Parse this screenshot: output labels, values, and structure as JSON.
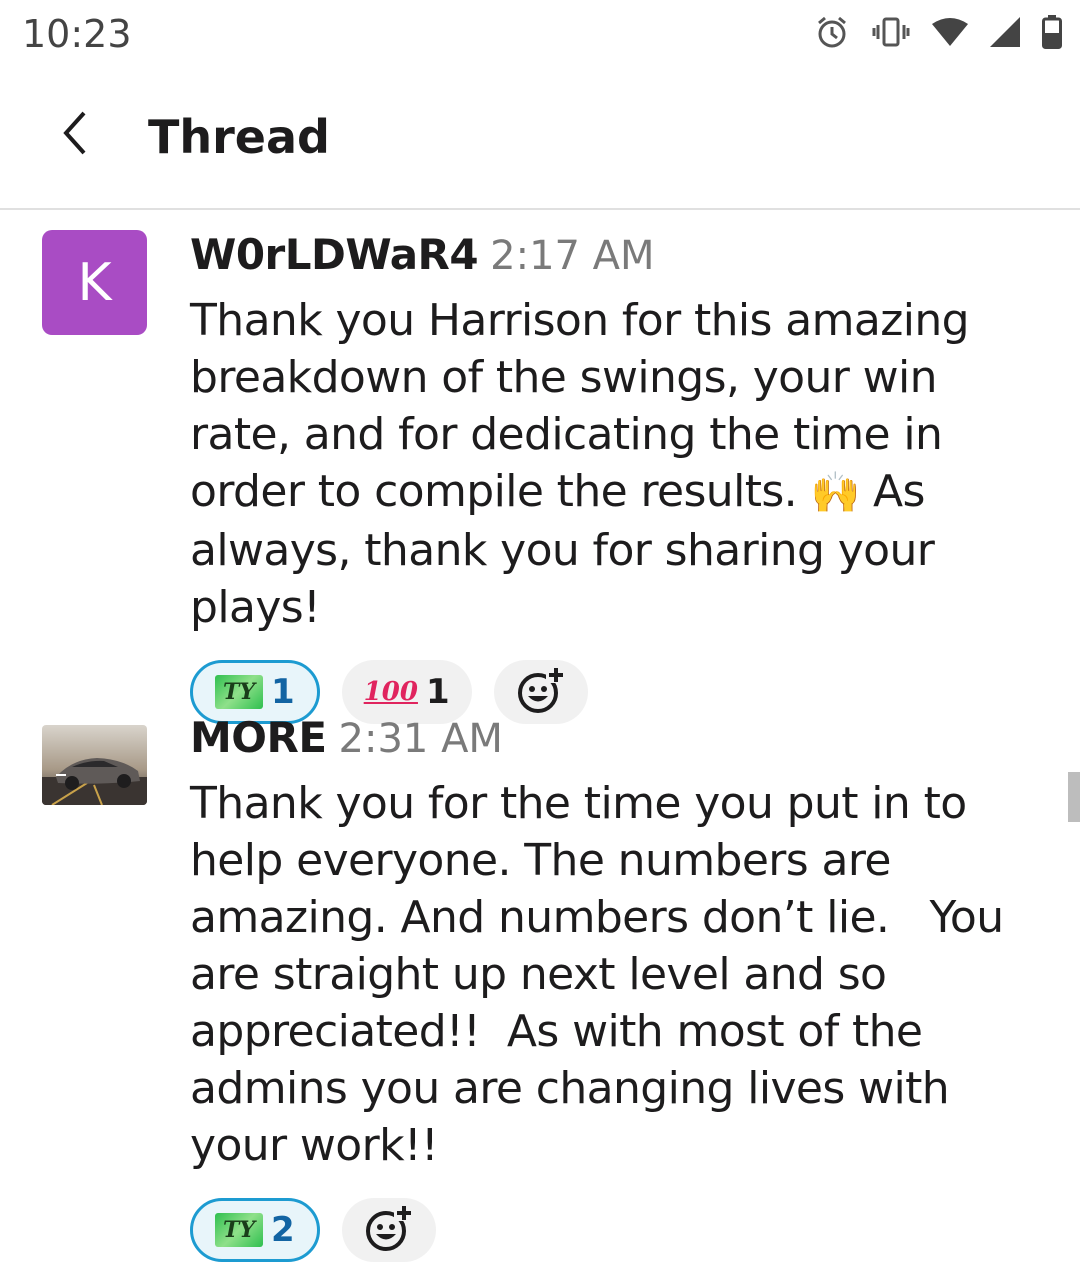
{
  "status_bar": {
    "time": "10:23",
    "icons": [
      "alarm-icon",
      "vibrate-icon",
      "wifi-icon",
      "signal-icon",
      "battery-icon"
    ]
  },
  "header": {
    "back_icon": "chevron-left-icon",
    "title": "Thread"
  },
  "messages": [
    {
      "author": "W0rLDWaR4",
      "time": "2:17 AM",
      "avatar": {
        "type": "letter",
        "letter": "K",
        "color": "#a94cc4"
      },
      "text_before_emoji": "Thank you Harrison for this amazing breakdown of the swings, your win rate, and for dedicating the time in order to compile the results. ",
      "inline_emoji": "🙌",
      "text_after_emoji": " As always, thank you for sharing your plays!",
      "reactions": [
        {
          "emoji": "TY",
          "count": "1",
          "active": true
        },
        {
          "emoji": "100",
          "count": "1",
          "active": false
        }
      ],
      "add_reaction_icon": "add-reaction-icon"
    },
    {
      "author": "MORE",
      "time": "2:31 AM",
      "avatar": {
        "type": "photo",
        "subject": "car"
      },
      "text": "Thank you for the time you put in to help everyone. The numbers are amazing. And numbers don’t lie.   You are straight up next level and so appreciated!!  As with most of the admins you are changing lives with your work!!",
      "reactions": [
        {
          "emoji": "TY",
          "count": "2",
          "active": true
        }
      ],
      "add_reaction_icon": "add-reaction-icon"
    }
  ],
  "colors": {
    "accent": "#1d9bd1",
    "avatar_k": "#a94cc4",
    "text": "#1d1c1d",
    "muted": "#7a7a7a"
  }
}
